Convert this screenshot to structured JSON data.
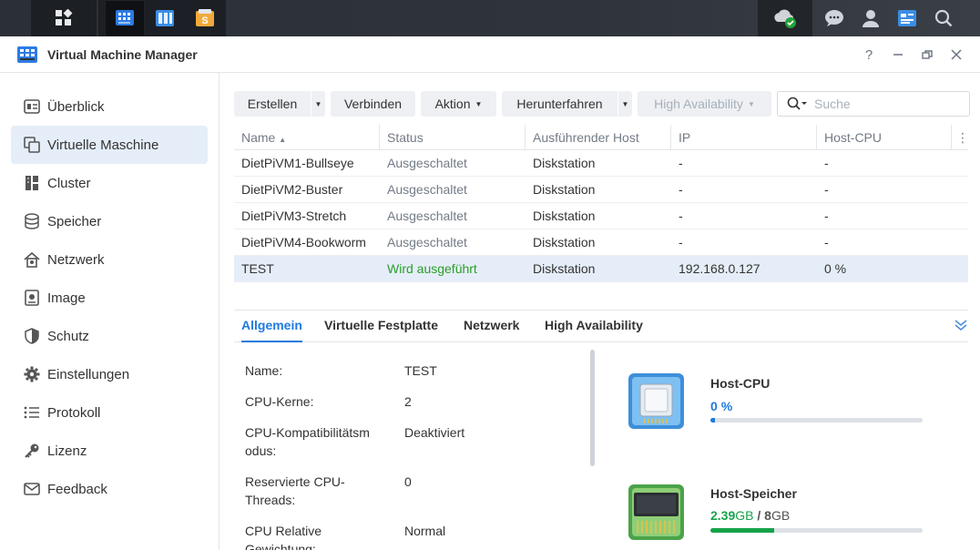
{
  "window": {
    "title": "Virtual Machine Manager"
  },
  "sidebar": {
    "items": [
      {
        "label": "Überblick",
        "icon": "overview-icon",
        "selected": false
      },
      {
        "label": "Virtuelle Maschine",
        "icon": "virtual-machine-icon",
        "selected": true
      },
      {
        "label": "Cluster",
        "icon": "cluster-icon",
        "selected": false
      },
      {
        "label": "Speicher",
        "icon": "storage-icon",
        "selected": false
      },
      {
        "label": "Netzwerk",
        "icon": "network-icon",
        "selected": false
      },
      {
        "label": "Image",
        "icon": "image-icon",
        "selected": false
      },
      {
        "label": "Schutz",
        "icon": "shield-icon",
        "selected": false
      },
      {
        "label": "Einstellungen",
        "icon": "gear-icon",
        "selected": false
      },
      {
        "label": "Protokoll",
        "icon": "log-icon",
        "selected": false
      },
      {
        "label": "Lizenz",
        "icon": "key-icon",
        "selected": false
      },
      {
        "label": "Feedback",
        "icon": "mail-icon",
        "selected": false
      }
    ]
  },
  "toolbar": {
    "create": "Erstellen",
    "connect": "Verbinden",
    "action": "Aktion",
    "shutdown": "Herunterfahren",
    "high_availability": "High Availability",
    "search_placeholder": "Suche"
  },
  "table": {
    "columns": [
      "Name",
      "Status",
      "Ausführender Host",
      "IP",
      "Host-CPU"
    ],
    "sort_column": "Name",
    "sort_dir": "asc",
    "rows": [
      {
        "name": "DietPiVM1-Bullseye",
        "status": "Ausgeschaltet",
        "host": "Diskstation",
        "ip": "-",
        "cpu": "-",
        "running": false,
        "selected": false
      },
      {
        "name": "DietPiVM2-Buster",
        "status": "Ausgeschaltet",
        "host": "Diskstation",
        "ip": "-",
        "cpu": "-",
        "running": false,
        "selected": false
      },
      {
        "name": "DietPiVM3-Stretch",
        "status": "Ausgeschaltet",
        "host": "Diskstation",
        "ip": "-",
        "cpu": "-",
        "running": false,
        "selected": false
      },
      {
        "name": "DietPiVM4-Bookworm",
        "status": "Ausgeschaltet",
        "host": "Diskstation",
        "ip": "-",
        "cpu": "-",
        "running": false,
        "selected": false
      },
      {
        "name": "TEST",
        "status": "Wird ausgeführt",
        "host": "Diskstation",
        "ip": "192.168.0.127",
        "cpu": "0 %",
        "running": true,
        "selected": true
      }
    ]
  },
  "details": {
    "tabs": [
      "Allgemein",
      "Virtuelle Festplatte",
      "Netzwerk",
      "High Availability"
    ],
    "active_tab": "Allgemein",
    "fields": [
      {
        "label": "Name:",
        "value": "TEST"
      },
      {
        "label": "CPU-Kerne:",
        "value": "2"
      },
      {
        "label": "CPU-Kompatibilitätsmodus:",
        "value": "Deaktiviert"
      },
      {
        "label": "Reservierte CPU-Threads:",
        "value": "0"
      },
      {
        "label": "CPU Relative Gewichtung:",
        "value": "Normal"
      }
    ]
  },
  "resources": {
    "cpu": {
      "title": "Host-CPU",
      "value": "0",
      "unit": "%",
      "percent": 0.02
    },
    "memory": {
      "title": "Host-Speicher",
      "used": "2.39",
      "used_unit": "GB",
      "separator": "/",
      "total": "8",
      "total_unit": "GB",
      "fraction": 0.2988
    }
  },
  "colors": {
    "accent": "#1f7ae0",
    "running": "#2a9d2a",
    "selected_bg": "#e5eef8",
    "memory_bar": "#16a34a"
  }
}
